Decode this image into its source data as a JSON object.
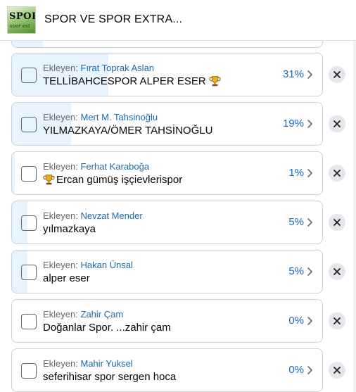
{
  "group": {
    "title": "SPOR VE SPOR EXTRA...",
    "logo_text": "SPOR",
    "logo_subtext": "spor ext"
  },
  "poll": {
    "added_by_label": "Ekleyen:",
    "options": [
      {
        "adder": "Fırat Toprak Aslan",
        "text": "TELLİBAHCESPOR ALPER ESER",
        "percent_label": "31%",
        "percent": 31,
        "icon": "trophy-icon",
        "icon_position": "after"
      },
      {
        "adder": "Mert M. Tahsinoğlu",
        "text": "YILMAZKAYA/ÖMER TAHSİNOĞLU",
        "percent_label": "19%",
        "percent": 19,
        "icon": "",
        "icon_position": ""
      },
      {
        "adder": "Ferhat Karaboğa",
        "text": "Ercan gümüş işçievlerispor",
        "percent_label": "1%",
        "percent": 1,
        "icon": "trophy-icon",
        "icon_position": "before"
      },
      {
        "adder": "Nevzat Mender",
        "text": "yılmazkaya",
        "percent_label": "5%",
        "percent": 5,
        "icon": "",
        "icon_position": ""
      },
      {
        "adder": "Hakan Ünsal",
        "text": "alper eser",
        "percent_label": "5%",
        "percent": 5,
        "icon": "",
        "icon_position": ""
      },
      {
        "adder": "Zahir Çam",
        "text": "Doğanlar Spor. ...zahir çam",
        "percent_label": "0%",
        "percent": 0,
        "icon": "",
        "icon_position": ""
      },
      {
        "adder": "Mahir Yuksel",
        "text": "seferihisar spor sergen hoca",
        "percent_label": "0%",
        "percent": 0,
        "icon": "",
        "icon_position": ""
      }
    ]
  },
  "colors": {
    "fill": "#e7f3ff",
    "percent": "#1b6ab4",
    "adder_name": "#1a6aa8",
    "border": "#ccd0d5"
  }
}
